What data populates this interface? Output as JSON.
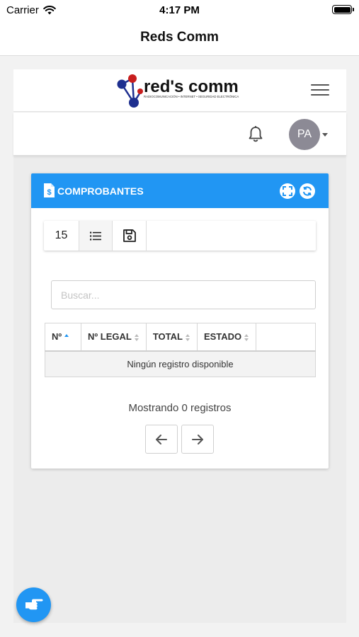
{
  "status_bar": {
    "carrier": "Carrier",
    "time": "4:17 PM",
    "battery_level": 1.0
  },
  "nav": {
    "title": "Reds Comm"
  },
  "brand": {
    "logo_text": "red's comm",
    "logo_tagline": "RADIOCOMUNICACIÓN • INTERNET • SEGURIDAD ELECTRÓNICA"
  },
  "user": {
    "initials": "PA"
  },
  "icons": {
    "menu": "hamburger-icon",
    "notifications": "bell-icon",
    "card": "invoice-icon",
    "expand": "expand-icon",
    "refresh": "refresh-icon",
    "columns": "list-icon",
    "save": "floppy-disk-icon",
    "prev": "arrow-left-icon",
    "next": "arrow-right-icon",
    "fab": "pointing-hand-icon"
  },
  "colors": {
    "accent": "#2196f3",
    "avatar": "#8c8a95",
    "logo_red": "#c81e1e",
    "logo_blue": "#1e2f8f"
  },
  "card": {
    "title": "COMPROBANTES",
    "toolbar": {
      "page_size": "15"
    },
    "search": {
      "placeholder": "Buscar...",
      "value": ""
    },
    "table": {
      "columns": [
        "Nº",
        "Nº LEGAL",
        "TOTAL",
        "ESTADO"
      ],
      "sorted_column": "Nº",
      "sort_direction": "asc",
      "empty_message": "Ningún registro disponible"
    },
    "footer": {
      "showing": "Mostrando 0 registros"
    }
  }
}
